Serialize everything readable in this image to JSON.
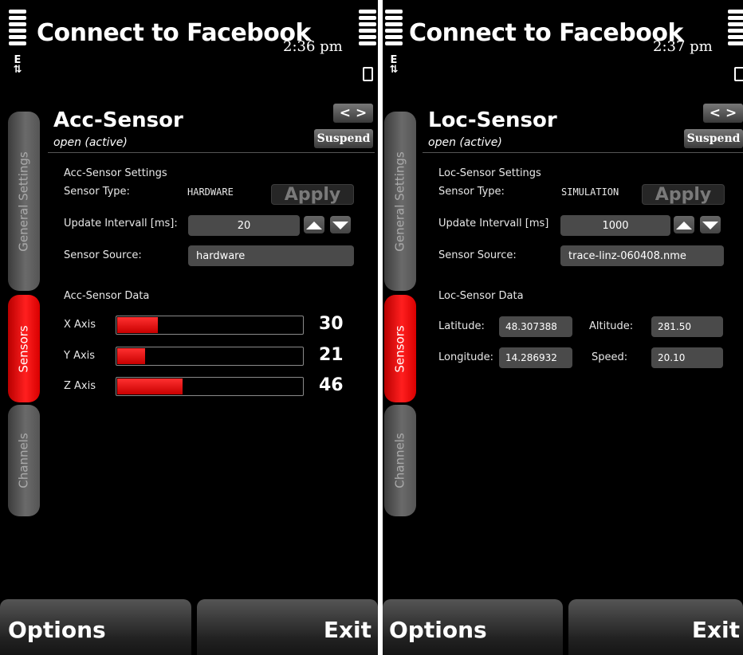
{
  "left": {
    "app_title": "Connect to Facebook",
    "clock": "2:36 pm",
    "network_indicator": "E",
    "tabs": [
      "General Settings",
      "Sensors",
      "Channels"
    ],
    "active_tab": "Sensors",
    "sensor_name": "Acc-Sensor",
    "sensor_status": "open (active)",
    "nav_label": "< >",
    "suspend_label": "Suspend",
    "settings_heading": "Acc-Sensor Settings",
    "sensor_type_label": "Sensor Type:",
    "sensor_type_value": "HARDWARE",
    "apply_label": "Apply",
    "update_interval_label": "Update Intervall [ms]:",
    "update_interval_value": "20",
    "sensor_source_label": "Sensor Source:",
    "sensor_source_value": "hardware",
    "data_heading": "Acc-Sensor Data",
    "axes": [
      {
        "label": "X Axis",
        "value": "30",
        "fill_fraction": 0.22
      },
      {
        "label": "Y Axis",
        "value": "21",
        "fill_fraction": 0.15
      },
      {
        "label": "Z Axis",
        "value": "46",
        "fill_fraction": 0.35
      }
    ],
    "softkey_left": "Options",
    "softkey_right": "Exit"
  },
  "right": {
    "app_title": "Connect to Facebook",
    "clock": "2:37 pm",
    "network_indicator": "E",
    "tabs": [
      "General Settings",
      "Sensors",
      "Channels"
    ],
    "active_tab": "Sensors",
    "sensor_name": "Loc-Sensor",
    "sensor_status": "open (active)",
    "nav_label": "< >",
    "suspend_label": "Suspend",
    "settings_heading": "Loc-Sensor Settings",
    "sensor_type_label": "Sensor Type:",
    "sensor_type_value": "SIMULATION",
    "apply_label": "Apply",
    "update_interval_label": "Update Intervall [ms]",
    "update_interval_value": "1000",
    "sensor_source_label": "Sensor Source:",
    "sensor_source_value": "trace-linz-060408.nme",
    "data_heading": "Loc-Sensor Data",
    "latitude_label": "Latitude:",
    "latitude_value": "48.307388",
    "altitude_label": "Altitude:",
    "altitude_value": "281.50",
    "longitude_label": "Longitude:",
    "longitude_value": "14.286932",
    "speed_label": "Speed:",
    "speed_value": "20.10",
    "softkey_left": "Options",
    "softkey_right": "Exit"
  },
  "colors": {
    "active_tab": "#e00000",
    "bar_fill": "#e60000",
    "field_bg": "#4a4a4a",
    "background": "#000000"
  },
  "icons": [
    "signal-strength-icon",
    "battery-icon",
    "network-e-icon",
    "arrow-up-icon",
    "arrow-down-icon"
  ]
}
